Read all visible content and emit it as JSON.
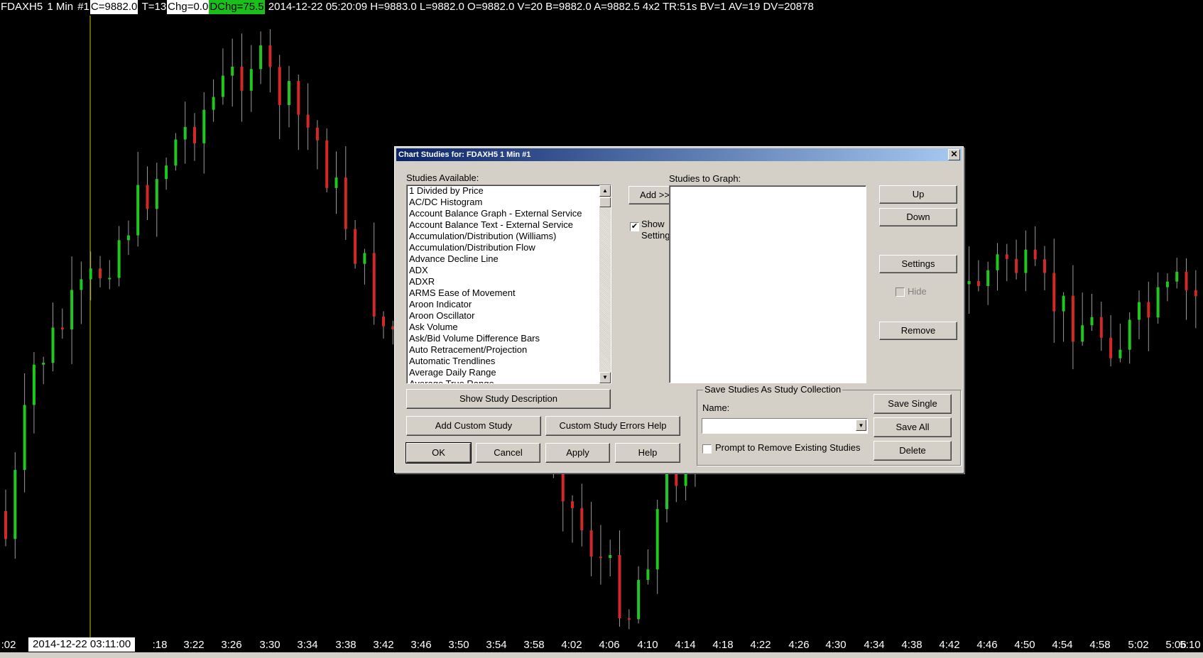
{
  "chart": {
    "header": {
      "symbol": "FDAXH5",
      "interval": "1 Min",
      "chart_no": "#1",
      "close": "C=9882.0",
      "trades": "T=13",
      "change": "Chg=0.0",
      "daily_change": "DChg=75.5",
      "rest": "2014-12-22 05:20:09 H=9883.0 L=9882.0 O=9882.0 V=20 B=9882.0 A=9882.5 4x2 TR:51s BV=1 AV=19 DV=20878"
    },
    "cursor_time": "2014-12-22  03:11:00",
    "time_labels": [
      ":02",
      ":18",
      "3:22",
      "3:26",
      "3:30",
      "3:34",
      "3:38",
      "3:42",
      "3:46",
      "3:50",
      "3:54",
      "3:58",
      "4:02",
      "4:06",
      "4:10",
      "4:14",
      "4:18",
      "4:22",
      "4:26",
      "4:30",
      "4:34",
      "4:38",
      "4:42",
      "4:46",
      "4:50",
      "4:54",
      "4:58",
      "5:02",
      "5:06",
      "5:10"
    ],
    "colors": {
      "up": "#1ec81e",
      "down": "#d42828",
      "wick": "#9a9a9a",
      "cursor": "#c8c800"
    }
  },
  "dialog": {
    "title": "Chart Studies for: FDAXH5  1 Min   #1",
    "studies_available_label": "Studies Available:",
    "studies_to_graph_label": "Studies to Graph:",
    "studies": [
      "1 Divided by Price",
      "AC/DC Histogram",
      "Account Balance Graph - External Service",
      "Account Balance Text - External Service",
      "Accumulation/Distribution (Williams)",
      "Accumulation/Distribution Flow",
      "Advance Decline Line",
      "ADX",
      "ADXR",
      "ARMS Ease of Movement",
      "Aroon Indicator",
      "Aroon Oscillator",
      "Ask Volume",
      "Ask/Bid Volume Difference Bars",
      "Auto Retracement/Projection",
      "Automatic Trendlines",
      "Average Daily Range",
      "Average True Range"
    ],
    "buttons": {
      "add": "Add >>",
      "up": "Up",
      "down": "Down",
      "settings": "Settings",
      "remove": "Remove",
      "show_desc": "Show Study Description",
      "add_custom": "Add Custom Study",
      "custom_errors": "Custom Study Errors Help",
      "ok": "OK",
      "cancel": "Cancel",
      "apply": "Apply",
      "help": "Help",
      "save_single": "Save Single",
      "save_all": "Save All",
      "delete": "Delete"
    },
    "show_settings_line1": "Show",
    "show_settings_line2": "Settings",
    "hide_label": "Hide",
    "save_group_title": "Save Studies As Study Collection",
    "name_label": "Name:",
    "name_value": "",
    "prompt_label": "Prompt to Remove Existing Studies",
    "show_settings_checked": true,
    "prompt_checked": false
  }
}
